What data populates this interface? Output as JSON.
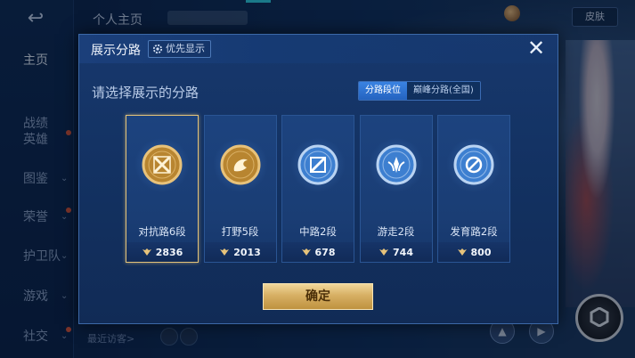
{
  "topbar": {
    "title": "个人主页",
    "skin_button": "皮肤"
  },
  "sidebar": {
    "back_icon": "back-arrow-icon",
    "items": [
      {
        "label": "主页",
        "active": true,
        "chevron": false,
        "dot": false
      },
      {
        "label": "战绩",
        "active": false,
        "chevron": false,
        "dot": false
      },
      {
        "label": "英雄",
        "active": false,
        "chevron": false,
        "dot": true
      },
      {
        "label": "图鉴",
        "active": false,
        "chevron": true,
        "dot": false
      },
      {
        "label": "荣誉",
        "active": false,
        "chevron": true,
        "dot": true
      },
      {
        "label": "护卫队",
        "active": false,
        "chevron": true,
        "dot": false
      },
      {
        "label": "游戏",
        "active": false,
        "chevron": true,
        "dot": false
      },
      {
        "label": "社交",
        "active": false,
        "chevron": true,
        "dot": true
      }
    ]
  },
  "footer": {
    "recent_visitors": "最近访客>"
  },
  "dialog": {
    "title": "展示分路",
    "priority_label": "优先显示",
    "close_icon": "close-icon",
    "prompt": "请选择展示的分路",
    "tabs": [
      {
        "label": "分路段位",
        "selected": true
      },
      {
        "label": "巅峰分路(全国)",
        "selected": false
      }
    ],
    "cards": [
      {
        "label": "对抗路6段",
        "score": "2836",
        "selected": true,
        "badge": "gold-crossed-swords-badge"
      },
      {
        "label": "打野5段",
        "score": "2013",
        "selected": false,
        "badge": "gold-jungle-badge"
      },
      {
        "label": "中路2段",
        "score": "678",
        "selected": false,
        "badge": "silver-mid-badge"
      },
      {
        "label": "游走2段",
        "score": "744",
        "selected": false,
        "badge": "silver-roam-badge"
      },
      {
        "label": "发育路2段",
        "score": "800",
        "selected": false,
        "badge": "silver-farm-badge"
      }
    ],
    "confirm_label": "确定"
  },
  "colors": {
    "gold": "#d7b064",
    "tab_blue": "#2f78d8",
    "panel": "#17386d"
  }
}
